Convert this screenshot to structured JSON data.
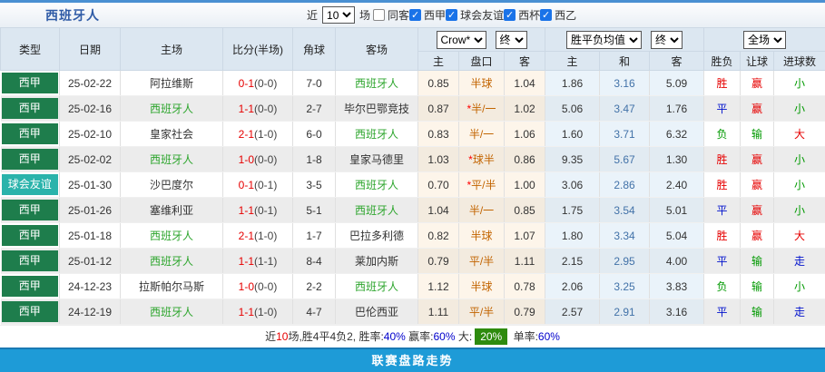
{
  "colors": {
    "top_border": "#4a90d2",
    "title_blue": "#2f5ba6",
    "header_bg": "#dce7f1",
    "league_green": "#1e7d4c",
    "friendly_teal": "#2ab3ab",
    "team_green": "#2ca52c",
    "score_red": "#e60000",
    "handicap_orange": "#c26400",
    "draw_blue": "#4272a8",
    "result_red": "#e60000",
    "result_blue": "#0011cc",
    "result_green": "#009900",
    "check_blue": "#1a73e8",
    "badge_green": "#2e8b0e",
    "footer_blue": "#1e9bd7",
    "footer_border": "#1979b3"
  },
  "header_bar": {
    "title": "西班牙人",
    "recent_label": "近",
    "recent_value": "10",
    "matches_label": "场",
    "checkboxes": [
      {
        "label": "同客",
        "checked": false
      },
      {
        "label": "西甲",
        "checked": true
      },
      {
        "label": "球会友谊",
        "checked": true
      },
      {
        "label": "西杯",
        "checked": true
      },
      {
        "label": "西乙",
        "checked": true
      }
    ]
  },
  "table": {
    "main_headers": [
      "类型",
      "日期",
      "主场",
      "比分(半场)",
      "角球",
      "客场"
    ],
    "dropdowns": {
      "odds_source": "Crow*",
      "odds_final": "终",
      "avg_label": "胜平负均值",
      "avg_final": "终",
      "scope": "全场"
    },
    "sub_headers": [
      "主",
      "盘口",
      "客",
      "主",
      "和",
      "客",
      "胜负",
      "让球",
      "进球数"
    ],
    "rows": [
      {
        "type": "西甲",
        "type_style": "league",
        "date": "25-02-22",
        "home": "阿拉维斯",
        "home_team": false,
        "score": "0-1",
        "half": "(0-0)",
        "corner": "7-0",
        "away": "西班牙人",
        "away_team": true,
        "odds_home": "0.85",
        "handicap_star": false,
        "handicap": "半球",
        "odds_away": "1.04",
        "avg_home": "1.86",
        "avg_draw": "3.16",
        "avg_away": "5.09",
        "result": "胜",
        "result_color": "red",
        "handicap_result": "赢",
        "handicap_result_color": "red",
        "goals": "小",
        "goals_color": "green"
      },
      {
        "type": "西甲",
        "type_style": "league",
        "date": "25-02-16",
        "home": "西班牙人",
        "home_team": true,
        "score": "1-1",
        "half": "(0-0)",
        "corner": "2-7",
        "away": "毕尔巴鄂竞技",
        "away_team": false,
        "odds_home": "0.87",
        "handicap_star": true,
        "handicap": "半/一",
        "odds_away": "1.02",
        "avg_home": "5.06",
        "avg_draw": "3.47",
        "avg_away": "1.76",
        "result": "平",
        "result_color": "blue",
        "handicap_result": "赢",
        "handicap_result_color": "red",
        "goals": "小",
        "goals_color": "green"
      },
      {
        "type": "西甲",
        "type_style": "league",
        "date": "25-02-10",
        "home": "皇家社会",
        "home_team": false,
        "score": "2-1",
        "half": "(1-0)",
        "corner": "6-0",
        "away": "西班牙人",
        "away_team": true,
        "odds_home": "0.83",
        "handicap_star": false,
        "handicap": "半/一",
        "odds_away": "1.06",
        "avg_home": "1.60",
        "avg_draw": "3.71",
        "avg_away": "6.32",
        "result": "负",
        "result_color": "green",
        "handicap_result": "输",
        "handicap_result_color": "green",
        "goals": "大",
        "goals_color": "red"
      },
      {
        "type": "西甲",
        "type_style": "league",
        "date": "25-02-02",
        "home": "西班牙人",
        "home_team": true,
        "score": "1-0",
        "half": "(0-0)",
        "corner": "1-8",
        "away": "皇家马德里",
        "away_team": false,
        "odds_home": "1.03",
        "handicap_star": true,
        "handicap": "球半",
        "odds_away": "0.86",
        "avg_home": "9.35",
        "avg_draw": "5.67",
        "avg_away": "1.30",
        "result": "胜",
        "result_color": "red",
        "handicap_result": "赢",
        "handicap_result_color": "red",
        "goals": "小",
        "goals_color": "green"
      },
      {
        "type": "球会友谊",
        "type_style": "friendly",
        "date": "25-01-30",
        "home": "沙巴度尔",
        "home_team": false,
        "score": "0-1",
        "half": "(0-1)",
        "corner": "3-5",
        "away": "西班牙人",
        "away_team": true,
        "odds_home": "0.70",
        "handicap_star": true,
        "handicap": "平/半",
        "odds_away": "1.00",
        "avg_home": "3.06",
        "avg_draw": "2.86",
        "avg_away": "2.40",
        "result": "胜",
        "result_color": "red",
        "handicap_result": "赢",
        "handicap_result_color": "red",
        "goals": "小",
        "goals_color": "green"
      },
      {
        "type": "西甲",
        "type_style": "league",
        "date": "25-01-26",
        "home": "塞维利亚",
        "home_team": false,
        "score": "1-1",
        "half": "(0-1)",
        "corner": "5-1",
        "away": "西班牙人",
        "away_team": true,
        "odds_home": "1.04",
        "handicap_star": false,
        "handicap": "半/一",
        "odds_away": "0.85",
        "avg_home": "1.75",
        "avg_draw": "3.54",
        "avg_away": "5.01",
        "result": "平",
        "result_color": "blue",
        "handicap_result": "赢",
        "handicap_result_color": "red",
        "goals": "小",
        "goals_color": "green"
      },
      {
        "type": "西甲",
        "type_style": "league",
        "date": "25-01-18",
        "home": "西班牙人",
        "home_team": true,
        "score": "2-1",
        "half": "(1-0)",
        "corner": "1-7",
        "away": "巴拉多利德",
        "away_team": false,
        "odds_home": "0.82",
        "handicap_star": false,
        "handicap": "半球",
        "odds_away": "1.07",
        "avg_home": "1.80",
        "avg_draw": "3.34",
        "avg_away": "5.04",
        "result": "胜",
        "result_color": "red",
        "handicap_result": "赢",
        "handicap_result_color": "red",
        "goals": "大",
        "goals_color": "red"
      },
      {
        "type": "西甲",
        "type_style": "league",
        "date": "25-01-12",
        "home": "西班牙人",
        "home_team": true,
        "score": "1-1",
        "half": "(1-1)",
        "corner": "8-4",
        "away": "莱加内斯",
        "away_team": false,
        "odds_home": "0.79",
        "handicap_star": false,
        "handicap": "平/半",
        "odds_away": "1.11",
        "avg_home": "2.15",
        "avg_draw": "2.95",
        "avg_away": "4.00",
        "result": "平",
        "result_color": "blue",
        "handicap_result": "输",
        "handicap_result_color": "green",
        "goals": "走",
        "goals_color": "blue"
      },
      {
        "type": "西甲",
        "type_style": "league",
        "date": "24-12-23",
        "home": "拉斯帕尔马斯",
        "home_team": false,
        "score": "1-0",
        "half": "(0-0)",
        "corner": "2-2",
        "away": "西班牙人",
        "away_team": true,
        "odds_home": "1.12",
        "handicap_star": false,
        "handicap": "半球",
        "odds_away": "0.78",
        "avg_home": "2.06",
        "avg_draw": "3.25",
        "avg_away": "3.83",
        "result": "负",
        "result_color": "green",
        "handicap_result": "输",
        "handicap_result_color": "green",
        "goals": "小",
        "goals_color": "green"
      },
      {
        "type": "西甲",
        "type_style": "league",
        "date": "24-12-19",
        "home": "西班牙人",
        "home_team": true,
        "score": "1-1",
        "half": "(1-0)",
        "corner": "4-7",
        "away": "巴伦西亚",
        "away_team": false,
        "odds_home": "1.11",
        "handicap_star": false,
        "handicap": "平/半",
        "odds_away": "0.79",
        "avg_home": "2.57",
        "avg_draw": "2.91",
        "avg_away": "3.16",
        "result": "平",
        "result_color": "blue",
        "handicap_result": "输",
        "handicap_result_color": "green",
        "goals": "走",
        "goals_color": "blue"
      }
    ]
  },
  "summary": {
    "segments": [
      {
        "text": "近",
        "style": "plain"
      },
      {
        "text": "10",
        "style": "red"
      },
      {
        "text": "场,胜4平4负2, 胜率:",
        "style": "plain"
      },
      {
        "text": "40%",
        "style": "blue"
      },
      {
        "text": " 赢率:",
        "style": "plain"
      },
      {
        "text": "60%",
        "style": "blue"
      },
      {
        "text": " 大:",
        "style": "plain"
      },
      {
        "text": "20%",
        "style": "badge"
      },
      {
        "text": " 单率:",
        "style": "plain"
      },
      {
        "text": "60%",
        "style": "blue"
      }
    ]
  },
  "footer": {
    "title": "联赛盘路走势"
  }
}
